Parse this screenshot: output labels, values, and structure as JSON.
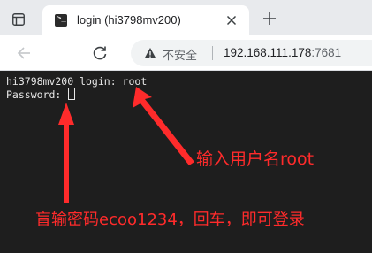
{
  "browser": {
    "tab_title": "login (hi3798mv200)",
    "favicon_glyph": ">_",
    "security_label": "不安全",
    "url_host": "192.168.111.178",
    "url_port": ":7681"
  },
  "terminal": {
    "lines": [
      "hi3798mv200 login: root",
      "Password: "
    ]
  },
  "annotations": {
    "username_hint": "输入用户名root",
    "password_hint": "盲输密码ecoo1234，回车，即可登录",
    "color": "#ff2b2b"
  },
  "colors": {
    "tabstrip": "#e8eaed",
    "terminal_bg": "#1e1e1e",
    "terminal_fg": "#e8e8e8"
  }
}
